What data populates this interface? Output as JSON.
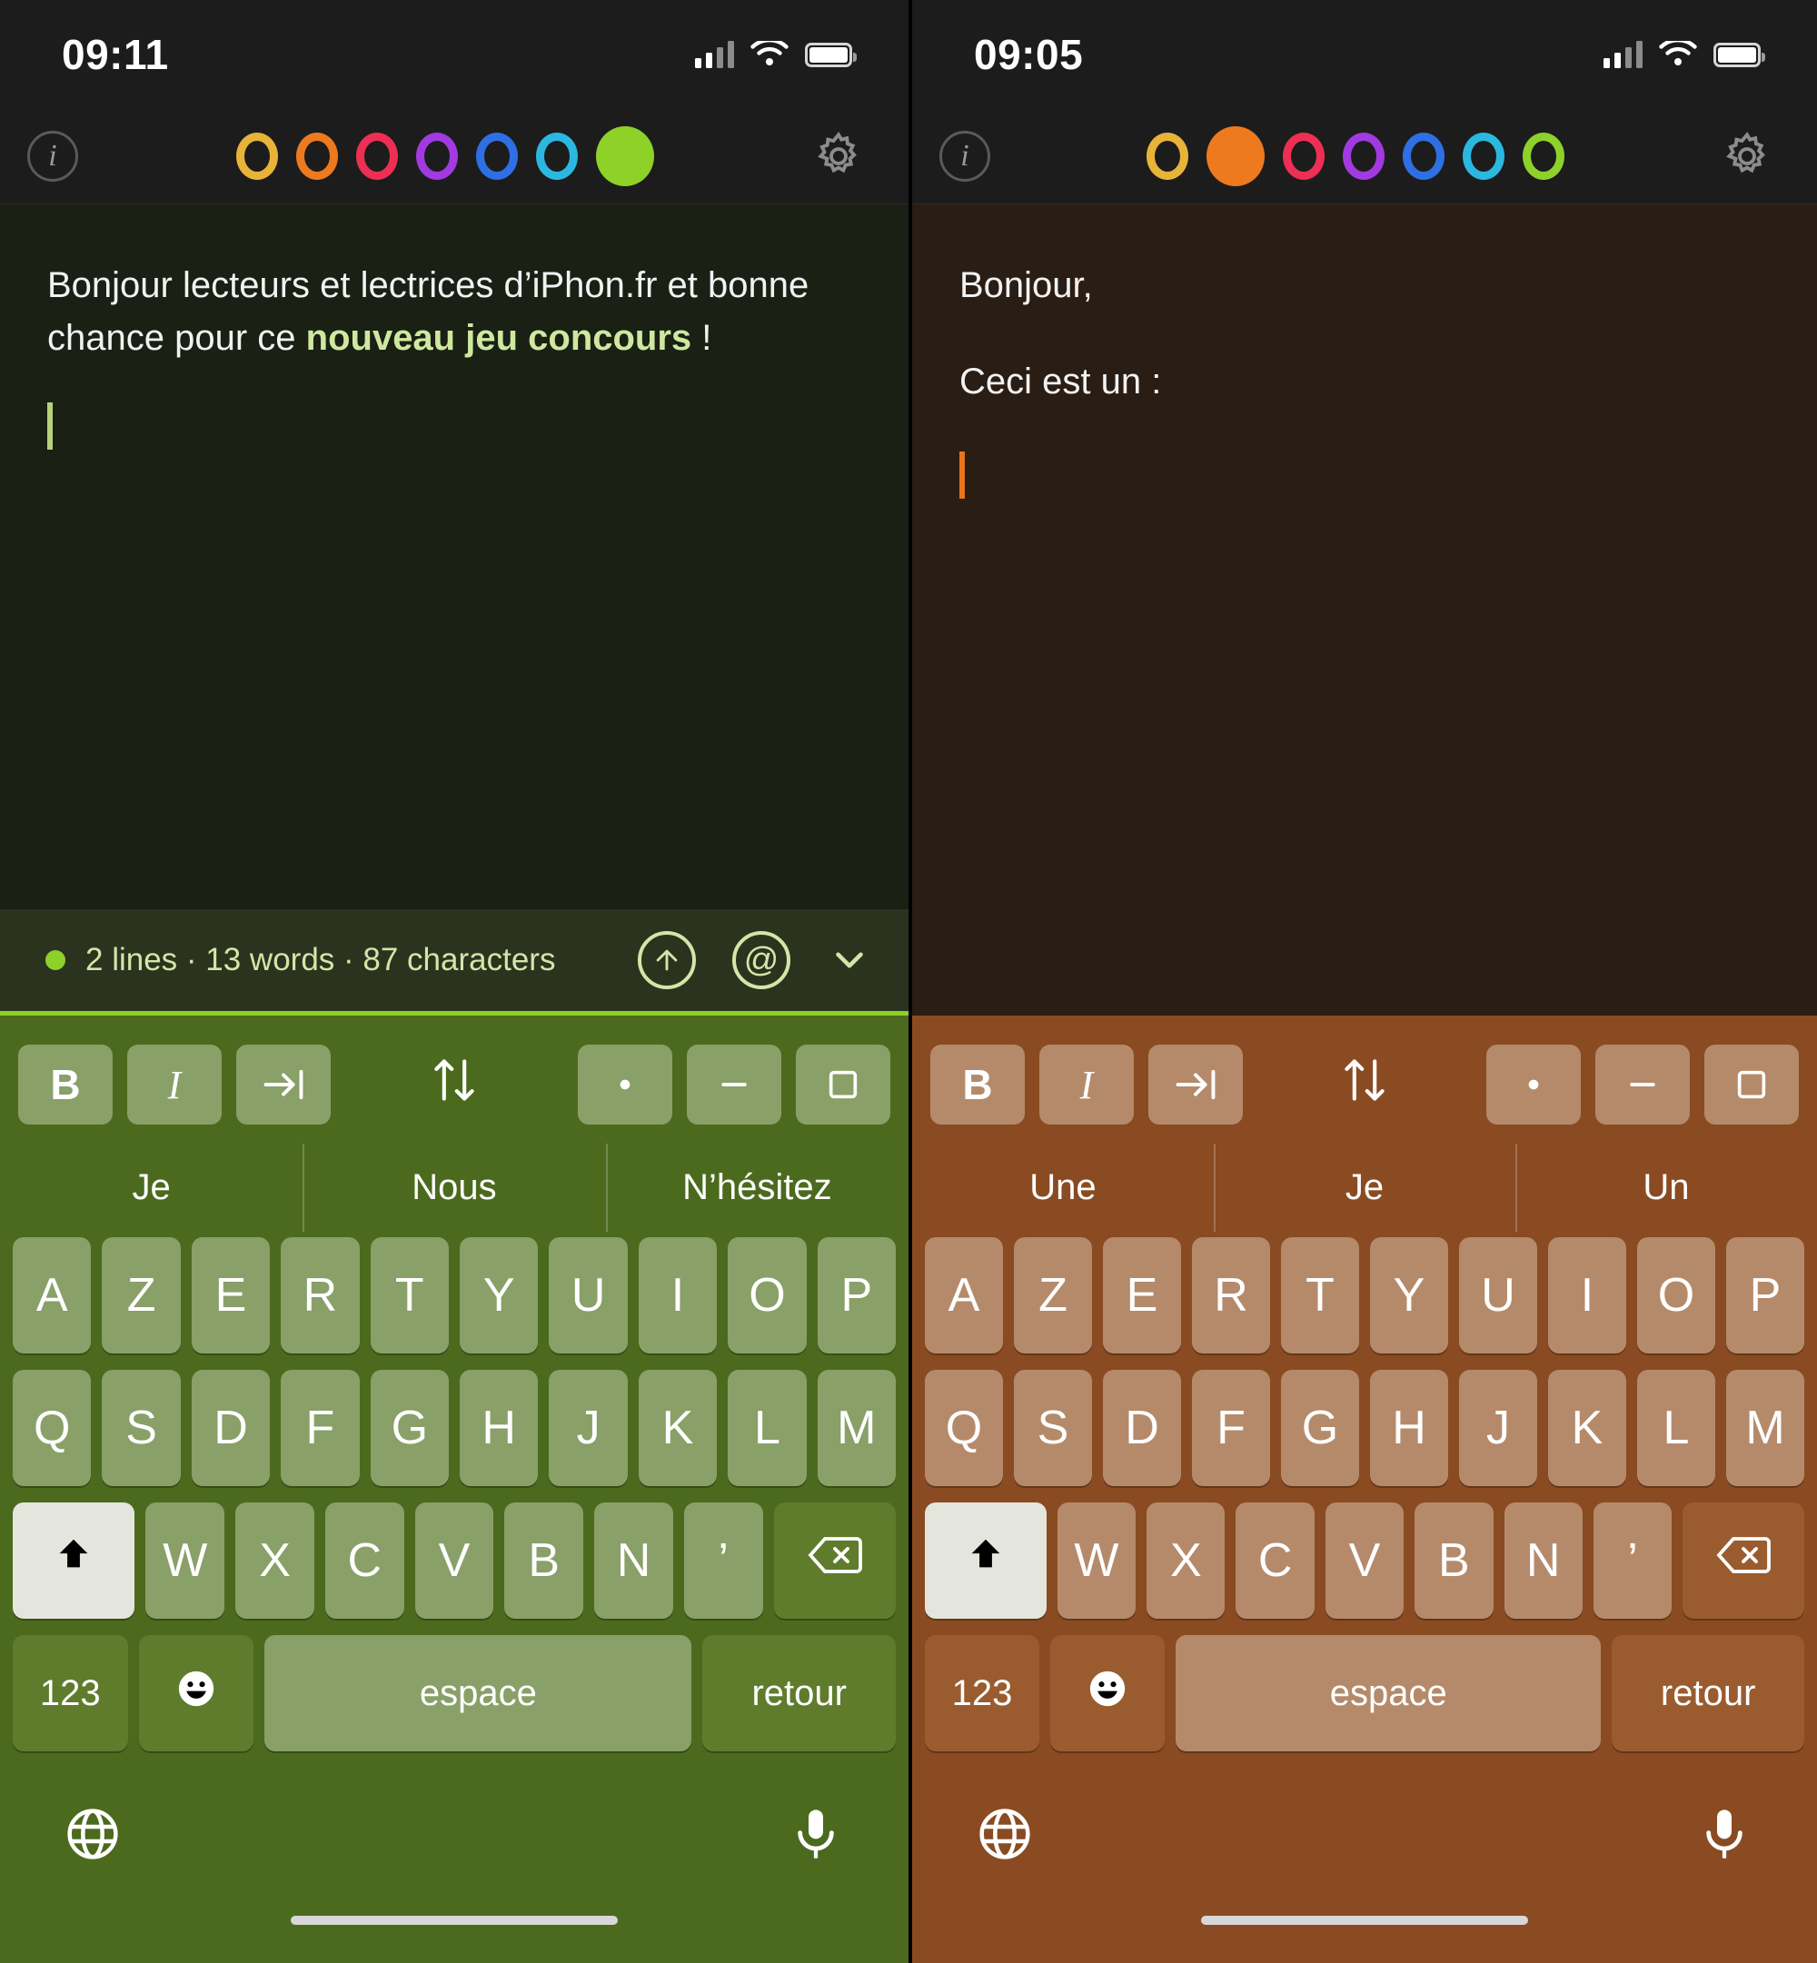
{
  "panels": [
    {
      "id": "left",
      "status": {
        "time": "09:11",
        "signal_icon": "cellular-bars-icon",
        "wifi_icon": "wifi-icon",
        "battery_icon": "battery-icon"
      },
      "toolbar": {
        "info_icon": "info-icon",
        "info_label": "i",
        "settings_icon": "gear-icon",
        "swatches": [
          {
            "name": "theme-swatch-yellow",
            "color": "#e8b339",
            "selected": false
          },
          {
            "name": "theme-swatch-orange",
            "color": "#ed7a1f",
            "selected": false
          },
          {
            "name": "theme-swatch-red",
            "color": "#ee2f54",
            "selected": false
          },
          {
            "name": "theme-swatch-purple",
            "color": "#a13ae0",
            "selected": false
          },
          {
            "name": "theme-swatch-blue",
            "color": "#2f6fe4",
            "selected": false
          },
          {
            "name": "theme-swatch-cyan",
            "color": "#2bb8e0",
            "selected": false
          },
          {
            "name": "theme-swatch-green",
            "color": "#8ed129",
            "selected": true
          }
        ]
      },
      "editor": {
        "background": "#1a2014",
        "text_color": "#f2f2f2",
        "line1_pre": "Bonjour lecteurs et lectrices d’iPhon.fr et bonne chance pour ce ",
        "line1_hl": "nouveau jeu concours",
        "line1_post": " !",
        "highlight_color": "#cfe8a0",
        "caret_color": "#b9d17a"
      },
      "info": {
        "bar_background": "#2b331f",
        "dot_color": "#8ed129",
        "text": "2 lines · 13 words · 87 characters",
        "text_color": "#d3e6a7",
        "share_icon": "arrow-up-circle-icon",
        "mention_icon": "at-circle-icon",
        "collapse_icon": "chevron-down-icon"
      },
      "keyboard": {
        "background": "#4c6a1e",
        "key_background": "#89a068",
        "key_background_dim": "#5f7c2c",
        "accent_line": "#8ed129",
        "format_keys": [
          {
            "name": "bold-button",
            "label": "B",
            "style": "bold"
          },
          {
            "name": "italic-button",
            "label": "I",
            "style": "ital"
          },
          {
            "name": "indent-button",
            "label": "→|",
            "style": "icon-indent"
          },
          {
            "name": "move-line-button",
            "label": "⇅",
            "style": "plain"
          },
          {
            "name": "bullet-list-button",
            "label": "·",
            "style": "icon"
          },
          {
            "name": "dash-list-button",
            "label": "–",
            "style": "icon"
          },
          {
            "name": "checkbox-list-button",
            "label": "□",
            "style": "icon"
          }
        ],
        "suggestions": [
          "Je",
          "Nous",
          "N’hésitez"
        ],
        "row1": [
          "A",
          "Z",
          "E",
          "R",
          "T",
          "Y",
          "U",
          "I",
          "O",
          "P"
        ],
        "row2": [
          "Q",
          "S",
          "D",
          "F",
          "G",
          "H",
          "J",
          "K",
          "L",
          "M"
        ],
        "row3": [
          "W",
          "X",
          "C",
          "V",
          "B",
          "N",
          "’"
        ],
        "shift_icon": "shift-arrow-icon",
        "delete_icon": "backspace-icon",
        "numbers_label": "123",
        "emoji_icon": "emoji-smiley-icon",
        "space_label": "espace",
        "return_label": "retour",
        "globe_icon": "globe-icon",
        "mic_icon": "microphone-icon",
        "shift_active": true
      }
    },
    {
      "id": "right",
      "status": {
        "time": "09:05",
        "signal_icon": "cellular-bars-icon",
        "wifi_icon": "wifi-icon",
        "battery_icon": "battery-icon"
      },
      "toolbar": {
        "info_icon": "info-icon",
        "info_label": "i",
        "settings_icon": "gear-icon",
        "swatches": [
          {
            "name": "theme-swatch-yellow",
            "color": "#e8b339",
            "selected": false
          },
          {
            "name": "theme-swatch-orange",
            "color": "#ed7a1f",
            "selected": true
          },
          {
            "name": "theme-swatch-red",
            "color": "#ee2f54",
            "selected": false
          },
          {
            "name": "theme-swatch-purple",
            "color": "#a13ae0",
            "selected": false
          },
          {
            "name": "theme-swatch-blue",
            "color": "#2f6fe4",
            "selected": false
          },
          {
            "name": "theme-swatch-cyan",
            "color": "#2bb8e0",
            "selected": false
          },
          {
            "name": "theme-swatch-green",
            "color": "#8ed129",
            "selected": false
          }
        ]
      },
      "editor": {
        "background": "#2a1d13",
        "text_color": "#f2f2f2",
        "line1": "Bonjour,",
        "line2": "Ceci est un :",
        "caret_color": "#e8741c"
      },
      "keyboard": {
        "background": "#8a4b22",
        "key_background": "#b58a6b",
        "key_background_dim": "#9a5c2f",
        "suggestions": [
          "Une",
          "Je",
          "Un"
        ],
        "row1": [
          "A",
          "Z",
          "E",
          "R",
          "T",
          "Y",
          "U",
          "I",
          "O",
          "P"
        ],
        "row2": [
          "Q",
          "S",
          "D",
          "F",
          "G",
          "H",
          "J",
          "K",
          "L",
          "M"
        ],
        "row3": [
          "W",
          "X",
          "C",
          "V",
          "B",
          "N",
          "’"
        ],
        "numbers_label": "123",
        "space_label": "espace",
        "return_label": "retour",
        "shift_active": true
      }
    }
  ]
}
